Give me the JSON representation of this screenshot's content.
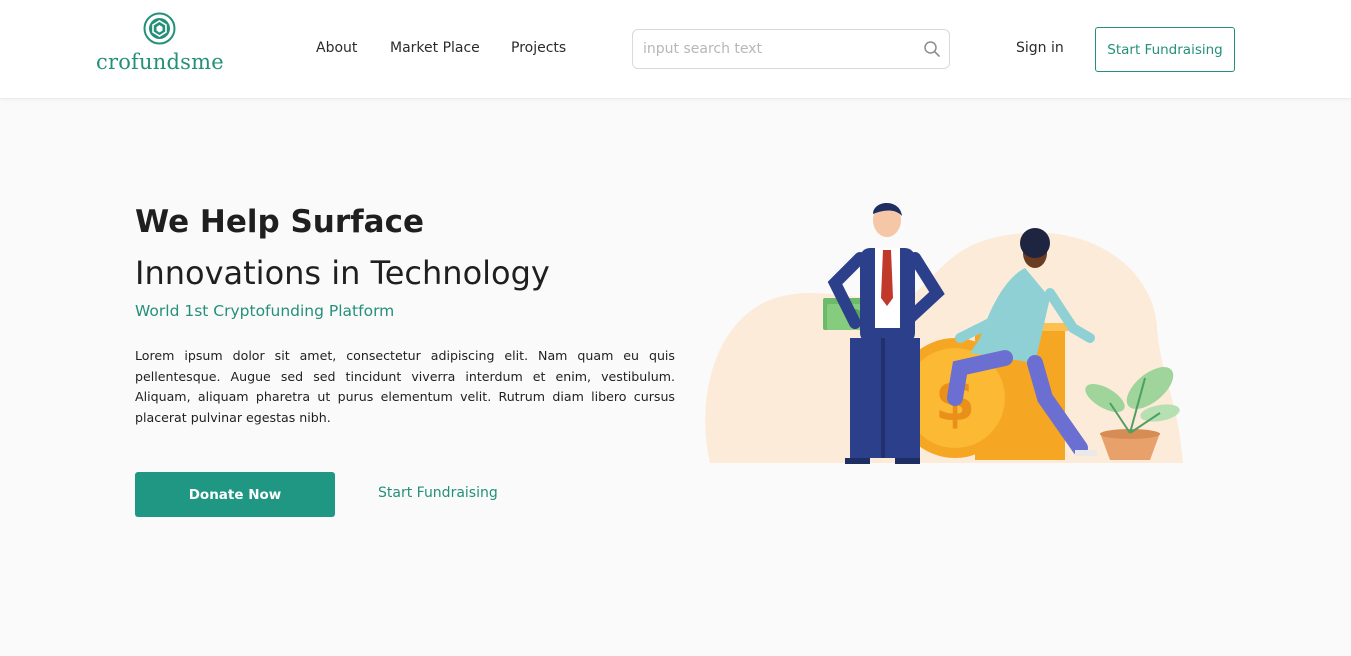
{
  "brand": {
    "name": "crofundsme",
    "accent": "#24907a",
    "primary_button_color": "#1f9783"
  },
  "nav": {
    "items": [
      "About",
      "Market Place",
      "Projects"
    ]
  },
  "search": {
    "placeholder": "input search text",
    "value": "",
    "icon": "search-icon"
  },
  "header_actions": {
    "sign_in": "Sign in",
    "start_fundraising": "Start Fundraising"
  },
  "hero": {
    "title": "We Help Surface",
    "subtitle": "Innovations in Technology",
    "tagline": "World 1st Cryptofunding Platform",
    "body": "Lorem ipsum dolor sit amet, consectetur adipiscing elit. Nam quam eu quis pellentesque. Augue sed sed tincidunt viverra interdum et enim, vestibulum. Aliquam, aliquam pharetra ut purus elementum velit. Rutrum diam libero cursus placerat pulvinar egestas nibh.",
    "donate_label": "Donate Now",
    "fundraising_label": "Start Fundraising"
  }
}
